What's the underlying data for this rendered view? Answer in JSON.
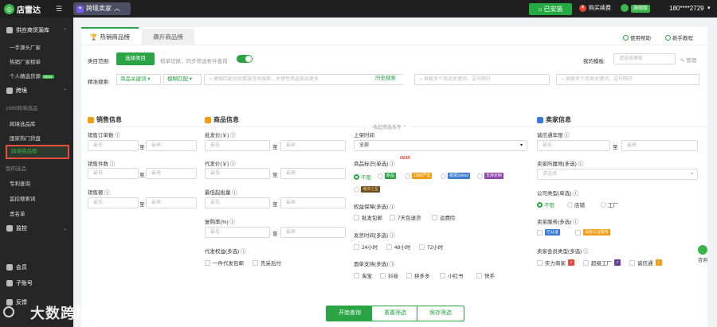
{
  "topbar": {
    "logo_text": "店雷达",
    "cross_label": "跨境卖家",
    "installed_label": "已安装",
    "buy_label": "购买续费",
    "badge": "旗舰版",
    "phone": "180****2729"
  },
  "sidebar": {
    "supply_header": "供应商货源库",
    "supply_items": [
      "一手源头厂家",
      "热销厂家榜单",
      "个人精选货源"
    ],
    "new_badge": "NEW",
    "cross_header": "跨境",
    "group_1688": "1688跨境选品",
    "cross_items": [
      "跨境选品库",
      "国家热门货盘"
    ],
    "active_item": "跨境商品榜",
    "group_mine": "我的选品",
    "mine_items": [
      "专利查询",
      "监控搜索词",
      "黑名单"
    ],
    "monitor_header": "监控",
    "member": "会员",
    "sub_account": "子账号",
    "feedback": "反馈"
  },
  "tabs": {
    "hot": "热销商品榜",
    "rise": "飙升商品榜"
  },
  "help": {
    "usage": "使用帮助",
    "tutorial": "新手教程"
  },
  "filters": {
    "category_label": "类目范围:",
    "select_category": "选择类目",
    "toggle_hint": "榜单切换，同步筛选条件查询",
    "my_template": "我的模板:",
    "template_placeholder": "请选择模板",
    "manage": "管理",
    "search_label": "精准搜索:",
    "keyword_select": "商品关键词",
    "match_select": "模糊匹配",
    "search_placeholder": "模糊匹配词后客服咨询搜索，关键性筛选商品更多",
    "history_search": "历史搜索",
    "multi_keyword_placeholder": "屏蔽多个商品关键词，逗号隔开",
    "multi_category_placeholder": "屏蔽多个品类关键词，逗号隔开",
    "fold_label": "收起筛选条件"
  },
  "sales": {
    "title": "销售信息",
    "orders_label": "销售订单数",
    "qty_label": "销售件数",
    "amount_label": "销售额",
    "min": "最低",
    "max": "最高",
    "to": "至"
  },
  "product": {
    "title": "商品信息",
    "wholesale_label": "批发价(￥)",
    "dropship_label": "代发价(￥)",
    "moq_label": "最低起批量",
    "repurchase_label": "复购率(%)",
    "dropship_rights_label": "代发权益(多选)",
    "rights_options": [
      "一件代发包邮",
      "先采后付"
    ]
  },
  "listing": {
    "time_label": "上架时间",
    "time_value": "全部",
    "tag_label": "商品标识(单选)",
    "tag_new": "NEW",
    "tag_none": "不限",
    "tag_options": [
      "新品",
      "1688严选",
      "跨境Select",
      "支持定制",
      "潮流之星"
    ],
    "guarantee_label": "权益保障(多选)",
    "guarantee_options": [
      "批发包邮",
      "7天包退货",
      "运费险"
    ],
    "ship_label": "发货时间(多选)",
    "ship_options": [
      "24小时",
      "48小时",
      "72小时"
    ],
    "platform_label": "面单支持(多选)",
    "platform_options": [
      "淘宝",
      "抖音",
      "拼多多",
      "小红书",
      "快手"
    ]
  },
  "seller": {
    "title": "卖家信息",
    "years_label": "诚信通年限",
    "region_label": "卖家所属地(多选)",
    "region_placeholder": "请选择",
    "company_label": "公司类型(单选)",
    "company_options": [
      "不限",
      "店铺",
      "工厂"
    ],
    "service_label": "卖家服务(多选)",
    "service_options": [
      "已认证",
      "深度认证服务"
    ],
    "member_label": "卖家会员类型(多选)",
    "member_options": [
      "实力商家",
      "超级工厂",
      "诚信通"
    ]
  },
  "footer": {
    "query": "开始查询",
    "reset": "重置筛选",
    "save": "保存筛选"
  },
  "float": {
    "consult": "咨询"
  },
  "watermark": "大数跨境",
  "colors": {
    "accent": "#2aa445",
    "sidebar_bg": "#262626",
    "topbar_bg": "#1f1f1f",
    "highlight_border": "#e74c3c"
  }
}
